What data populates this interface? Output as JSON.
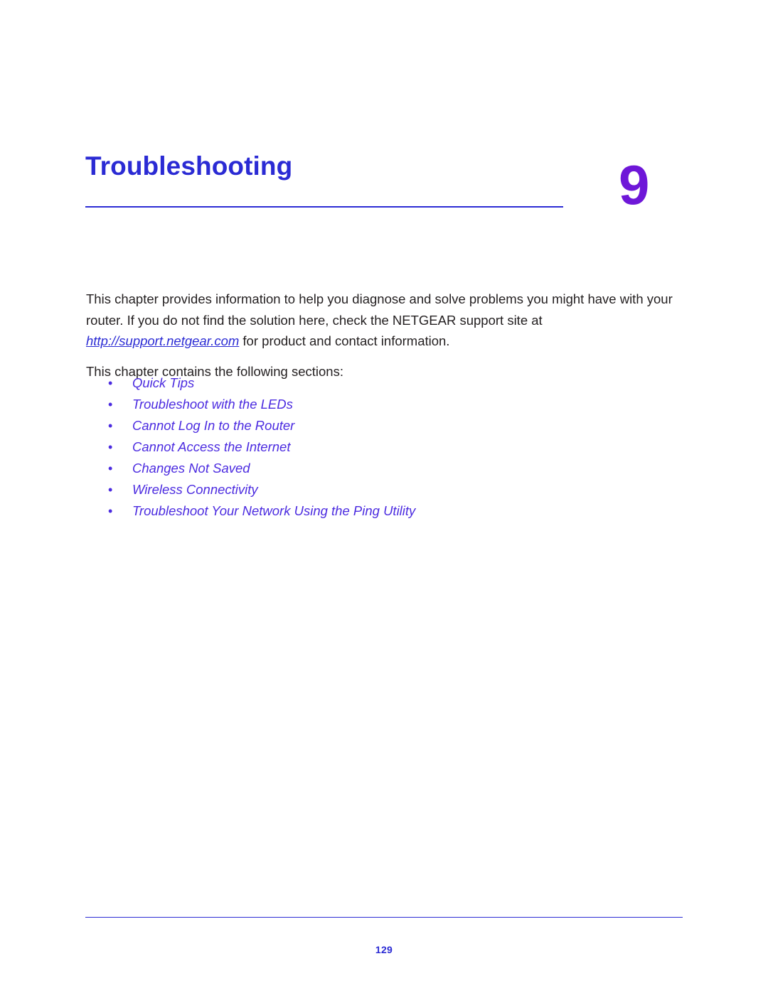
{
  "chapter": {
    "title": "Troubleshooting",
    "number": "9",
    "accent_color": "#2b2bd4",
    "number_color": "#6e17d8"
  },
  "intro": {
    "paragraph_part1": "This chapter provides information to help you diagnose and solve problems you might have with your router. If you do not find the solution here, check the NETGEAR support site at ",
    "link_text": "http://support.netgear.com",
    "paragraph_part2": " for product and contact information.",
    "second_line": "This chapter contains the following sections:"
  },
  "sections": [
    {
      "bullet": "•",
      "label": "Quick Tips"
    },
    {
      "bullet": "•",
      "label": "Troubleshoot with the LEDs"
    },
    {
      "bullet": "•",
      "label": "Cannot Log In to the Router"
    },
    {
      "bullet": "•",
      "label": "Cannot Access the Internet"
    },
    {
      "bullet": "•",
      "label": "Changes Not Saved"
    },
    {
      "bullet": "•",
      "label": "Wireless Connectivity"
    },
    {
      "bullet": "•",
      "label": "Troubleshoot Your Network Using the Ping Utility"
    }
  ],
  "footer": {
    "page_number": "129"
  }
}
